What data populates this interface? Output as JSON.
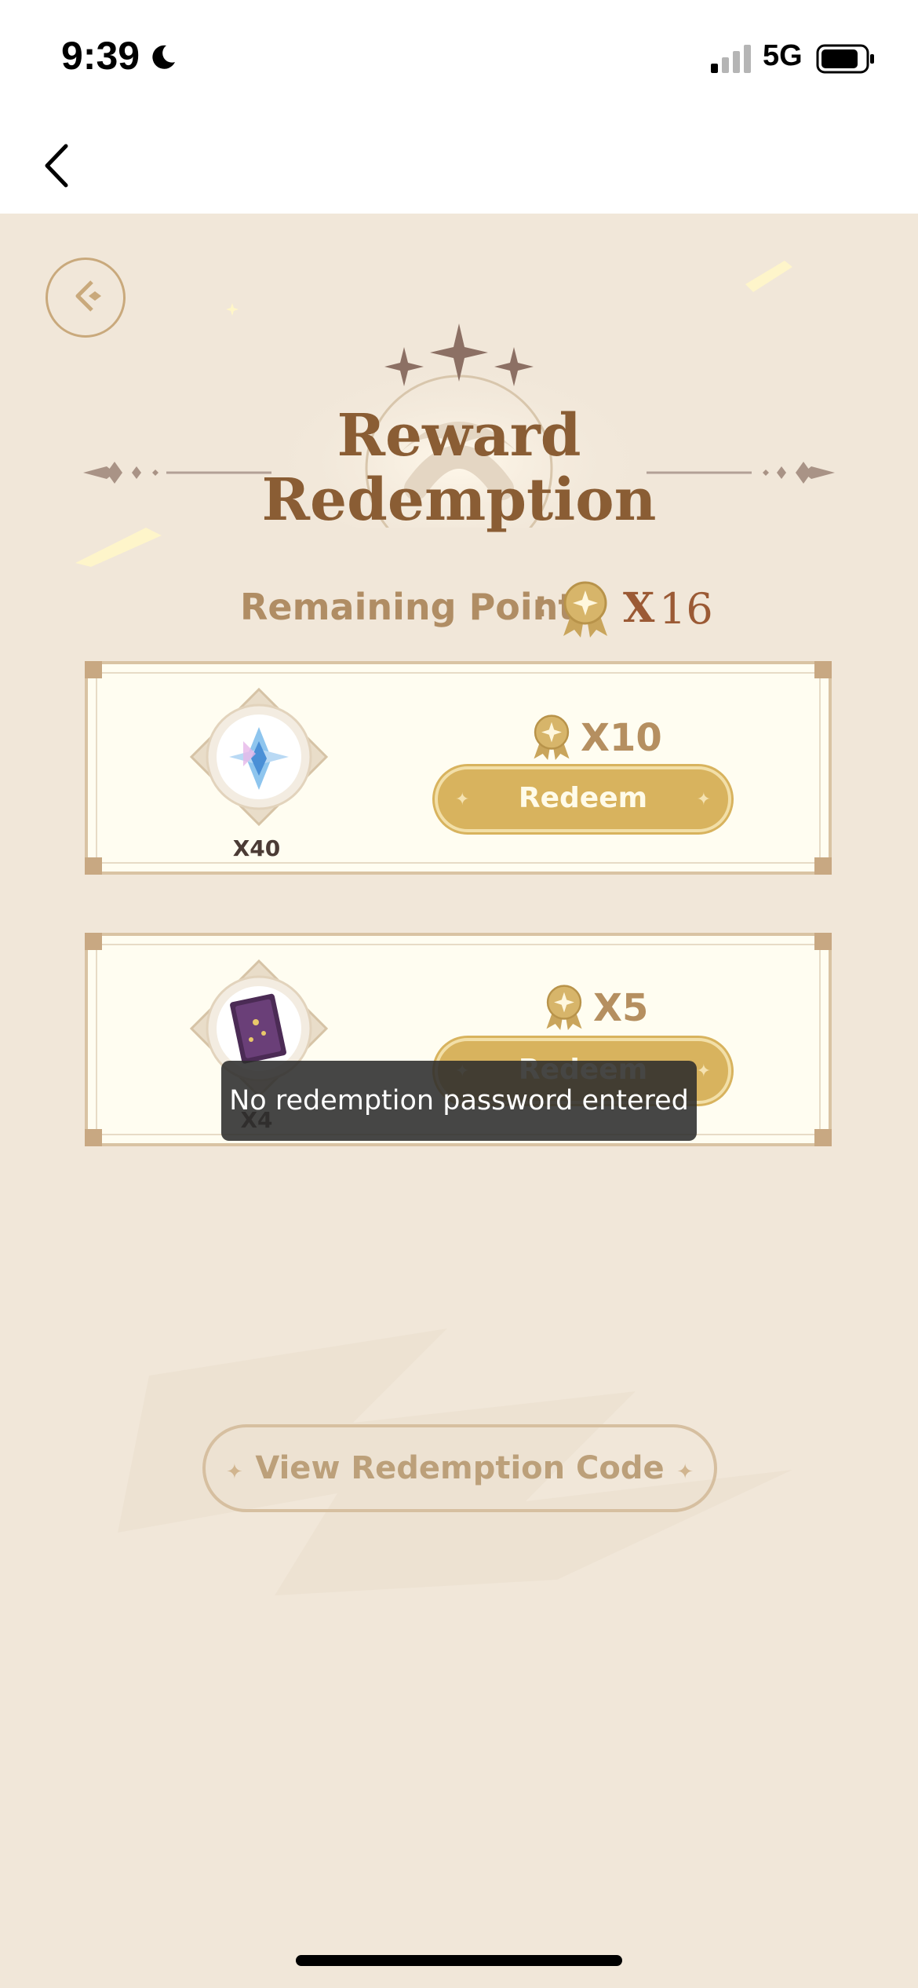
{
  "status_bar": {
    "time": "9:39",
    "network": "5G"
  },
  "page": {
    "title_line1": "Reward",
    "title_line2": "Redemption",
    "points_label": "Remaining Points",
    "points_colon": ":",
    "points_prefix": "X",
    "points_value": "16"
  },
  "rewards": [
    {
      "item_icon": "primogem-icon",
      "quantity": "X40",
      "cost": "X10",
      "button_label": "Redeem"
    },
    {
      "item_icon": "book-icon",
      "quantity": "X4",
      "cost": "X5",
      "button_label": "Redeem"
    }
  ],
  "toast": {
    "message": "No redemption password entered"
  },
  "view_code": {
    "label": "View Redemption Code"
  },
  "colors": {
    "accent": "#d8b35e",
    "title": "#8a5d34",
    "points": "#9b5a35",
    "background": "#f1e7d9"
  }
}
